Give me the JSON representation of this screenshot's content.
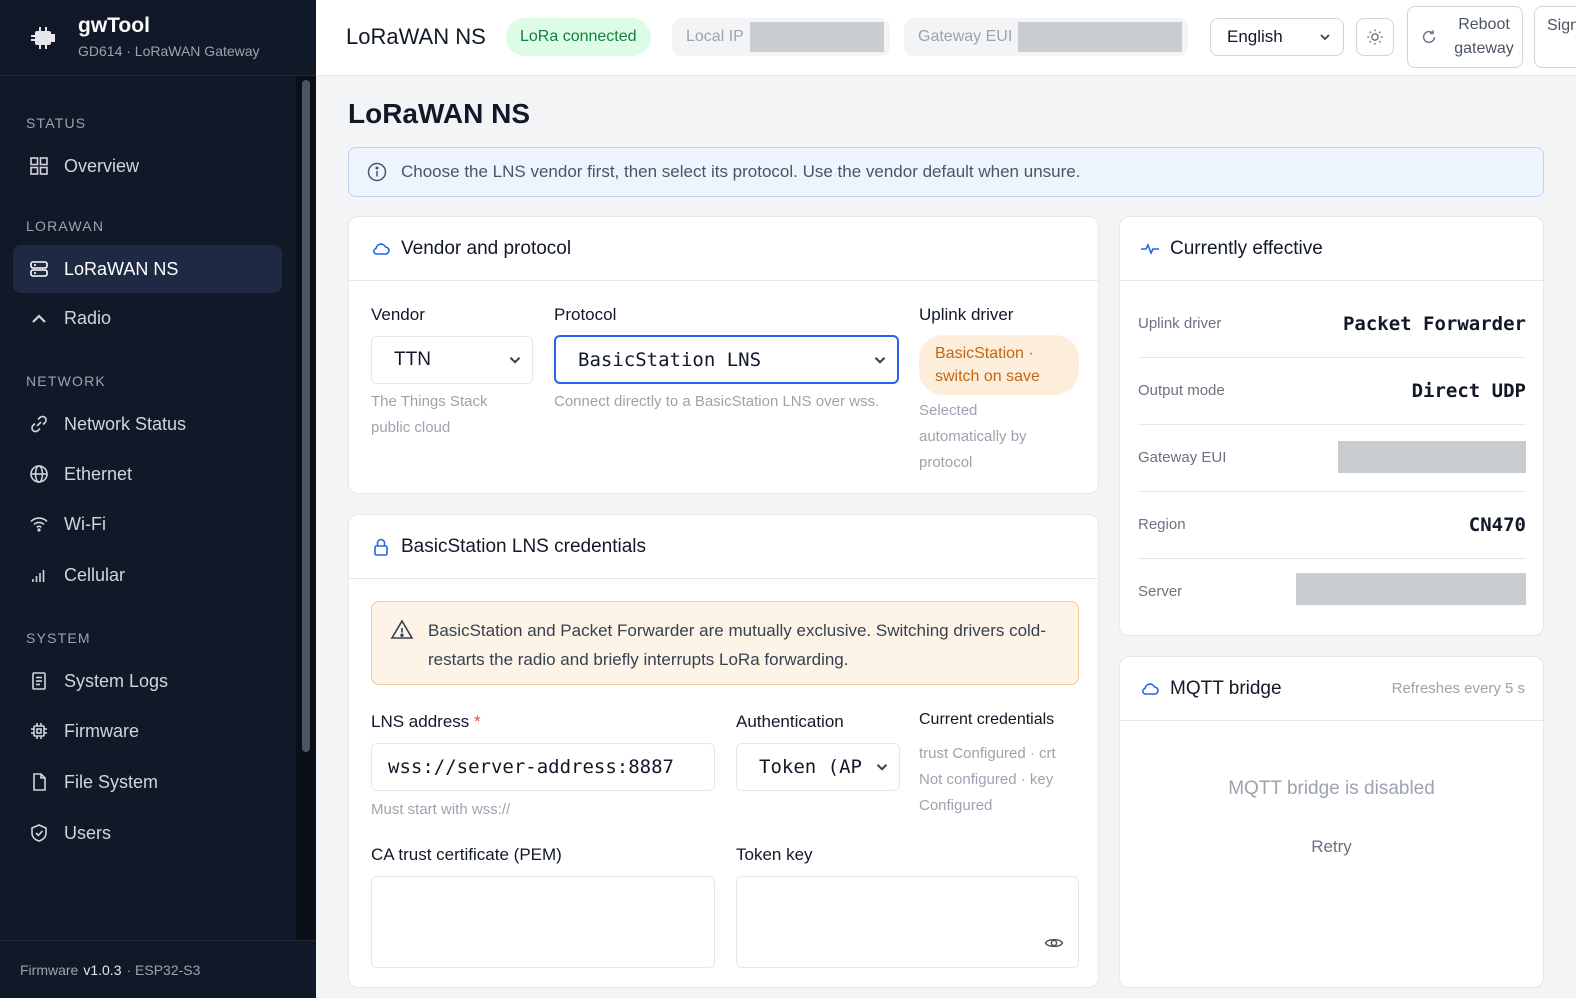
{
  "brand": {
    "name": "gwTool",
    "subtitle": "GD614 · LoRaWAN Gateway"
  },
  "nav": {
    "sections": {
      "status": "STATUS",
      "lorawan": "LORAWAN",
      "network": "NETWORK",
      "system": "SYSTEM"
    },
    "items": {
      "overview": "Overview",
      "lorawan_ns": "LoRaWAN NS",
      "radio": "Radio",
      "network_status": "Network Status",
      "ethernet": "Ethernet",
      "wifi": "Wi-Fi",
      "cellular": "Cellular",
      "system_logs": "System Logs",
      "firmware": "Firmware",
      "file_system": "File System",
      "users": "Users"
    },
    "active": "lorawan_ns"
  },
  "footer": {
    "firmware_label": "Firmware",
    "version": "v1.0.3",
    "chip": "· ESP32-S3"
  },
  "topbar": {
    "title": "LoRaWAN NS",
    "lora_status": "LoRa connected",
    "local_ip_label": "Local IP",
    "gateway_eui_label": "Gateway EUI",
    "language": "English",
    "reboot_label": "Reboot gateway",
    "signout_label": "Sign out"
  },
  "page": {
    "title": "LoRaWAN NS",
    "info": "Choose the LNS vendor first, then select its protocol. Use the vendor default when unsure."
  },
  "vendor_card": {
    "title": "Vendor and protocol",
    "vendor_label": "Vendor",
    "vendor_value": "TTN",
    "vendor_help": "The Things Stack public cloud",
    "protocol_label": "Protocol",
    "protocol_value": "BasicStation LNS",
    "protocol_help": "Connect directly to a BasicStation LNS over wss.",
    "uplink_label": "Uplink driver",
    "uplink_badge": "BasicStation · switch on save",
    "uplink_help": "Selected automatically by protocol"
  },
  "credentials_card": {
    "title": "BasicStation LNS credentials",
    "warning": "BasicStation and Packet Forwarder are mutually exclusive. Switching drivers cold-restarts the radio and briefly interrupts LoRa forwarding.",
    "lns_label": "LNS address",
    "lns_required": "*",
    "lns_value": "wss://server-address:8887",
    "lns_help": "Must start with wss://",
    "auth_label": "Authentication",
    "auth_value": "Token (AP",
    "current_label": "Current credentials",
    "current_lines": [
      "trust Configured · crt",
      "Not configured · key",
      "Configured"
    ],
    "ca_label": "CA trust certificate (PEM)",
    "token_label": "Token key"
  },
  "effective_card": {
    "title": "Currently effective",
    "rows": {
      "uplink_label": "Uplink driver",
      "uplink_value": "Packet Forwarder",
      "output_label": "Output mode",
      "output_value": "Direct UDP",
      "eui_label": "Gateway EUI",
      "region_label": "Region",
      "region_value": "CN470",
      "server_label": "Server"
    }
  },
  "mqtt_card": {
    "title": "MQTT bridge",
    "refresh": "Refreshes every 5 s",
    "empty": "MQTT bridge is disabled",
    "retry": "Retry"
  },
  "colors": {
    "sidebar_bg": "#111827",
    "active_bg": "#1e2a44",
    "accent": "#2563eb",
    "success": "#15803d",
    "warning": "#c2670f"
  }
}
